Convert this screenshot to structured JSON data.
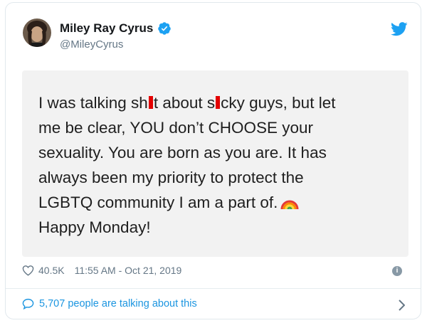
{
  "account": {
    "display_name": "Miley Ray Cyrus",
    "handle": "@MileyCyrus",
    "verified": true
  },
  "tweet": {
    "lines": {
      "l1_a": "I was talking sh",
      "l1_b": "t about s",
      "l1_c": "cky guys, but let",
      "l2": "me be clear, YOU don’t CHOOSE your",
      "l3": "sexuality. You are born as you are. It has",
      "l4": "always been my priority to protect the",
      "l5": "LGBTQ community I am a part of.",
      "l6": "Happy Monday!"
    },
    "emoji": "rainbow"
  },
  "stats": {
    "likes": "40.5K",
    "timestamp": "11:55 AM - Oct 21, 2019"
  },
  "footer": {
    "talking": "5,707 people are talking about this"
  },
  "colors": {
    "brand_blue": "#1da1f2",
    "link_blue": "#1b95e0",
    "censor_red": "#e30000",
    "muted_gray": "#657786"
  },
  "icons": {
    "verified": "verified-badge-icon",
    "logo": "twitter-bird-icon",
    "like": "heart-icon",
    "info": "info-icon",
    "reply": "speech-bubble-icon",
    "more": "chevron-right-icon"
  }
}
